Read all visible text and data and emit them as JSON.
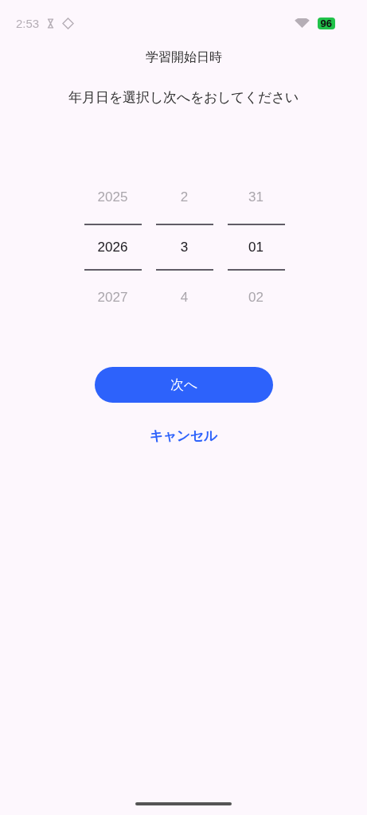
{
  "status_bar": {
    "time": "2:53",
    "battery": "96"
  },
  "title": "学習開始日時",
  "instruction": "年月日を選択し次へをおしてください",
  "pickers": [
    {
      "items": [
        {
          "label": "2025",
          "selected": false
        },
        {
          "label": "2026",
          "selected": true
        },
        {
          "label": "2027",
          "selected": false
        }
      ]
    },
    {
      "items": [
        {
          "label": "2",
          "selected": false
        },
        {
          "label": "3",
          "selected": true
        },
        {
          "label": "4",
          "selected": false
        }
      ]
    },
    {
      "items": [
        {
          "label": "31",
          "selected": false
        },
        {
          "label": "01",
          "selected": true
        },
        {
          "label": "02",
          "selected": false
        }
      ]
    }
  ],
  "next_button": "次へ",
  "cancel_link": "キャンセル"
}
